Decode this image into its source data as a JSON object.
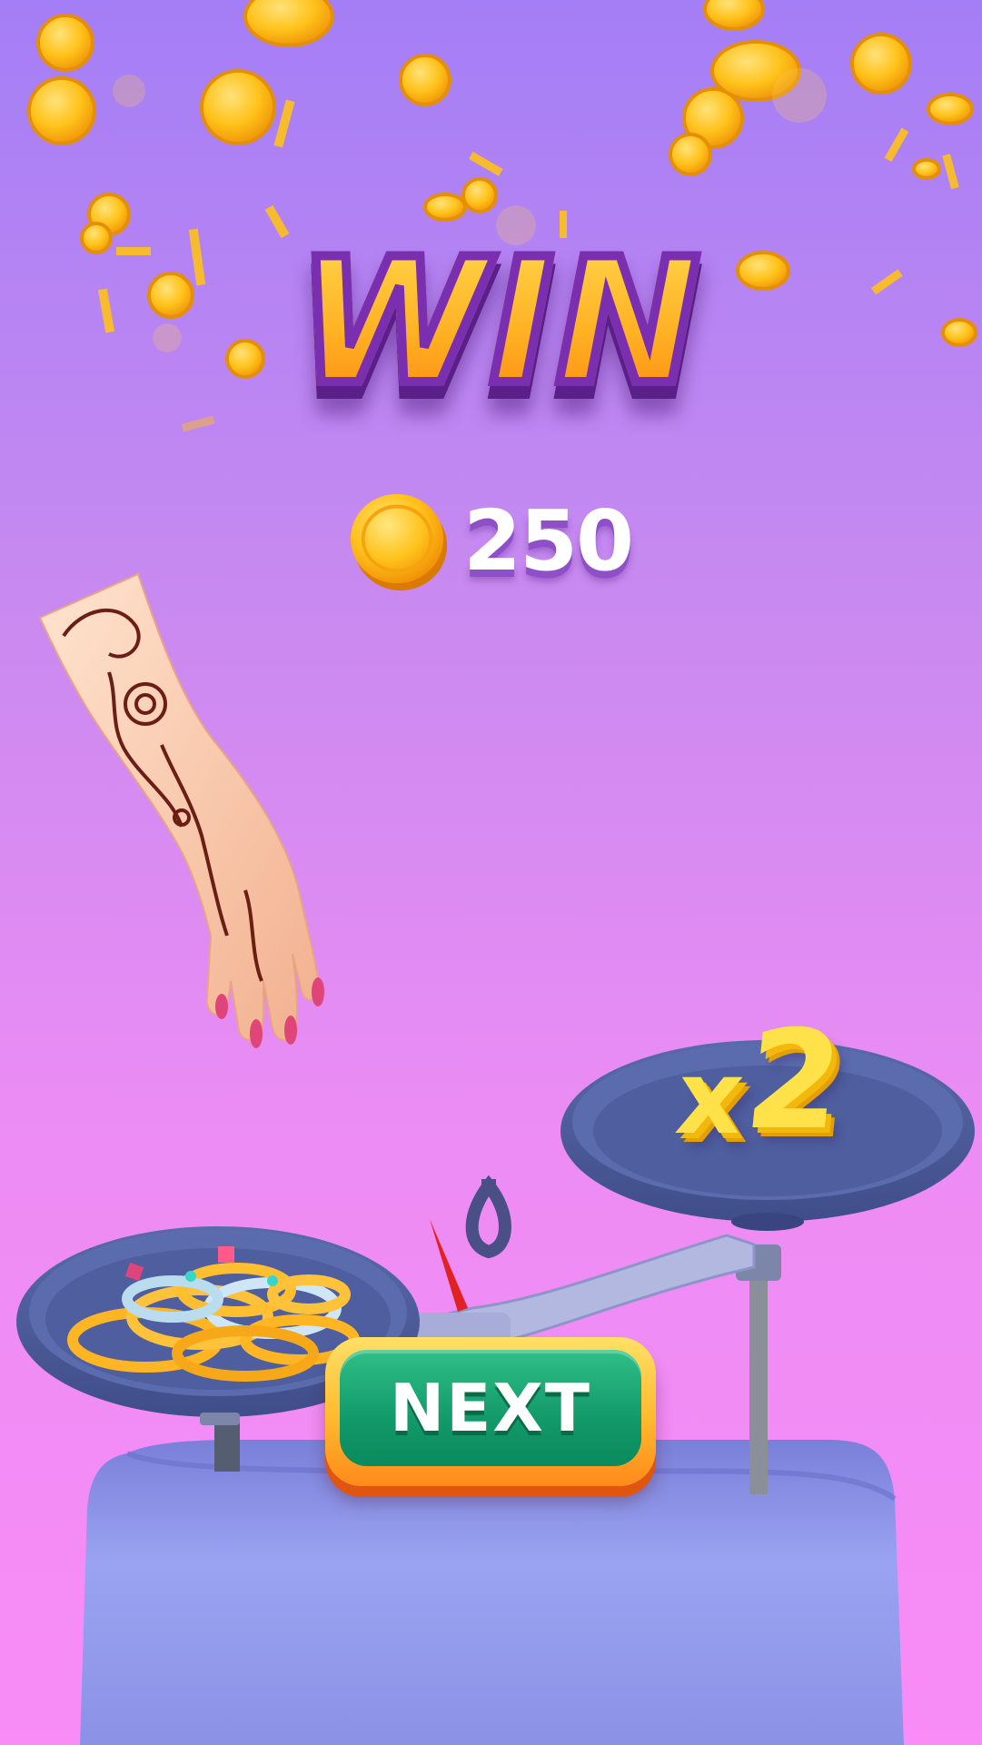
{
  "title": "WIN",
  "reward": {
    "amount": "250",
    "icon": "coin-icon"
  },
  "multiplier": {
    "prefix": "x",
    "value": "2"
  },
  "buttons": {
    "next_label": "NEXT"
  },
  "colors": {
    "background_top": "#a47ef6",
    "background_bottom": "#f98cf7",
    "title_fill": "#ffb224",
    "title_outline": "#7a2fb0",
    "coin": "#ffc21a",
    "next_button": "#12996a",
    "next_button_border": "#ffb92e",
    "scale_pan": "#6272b0",
    "scale_base": "#8d96ea"
  }
}
